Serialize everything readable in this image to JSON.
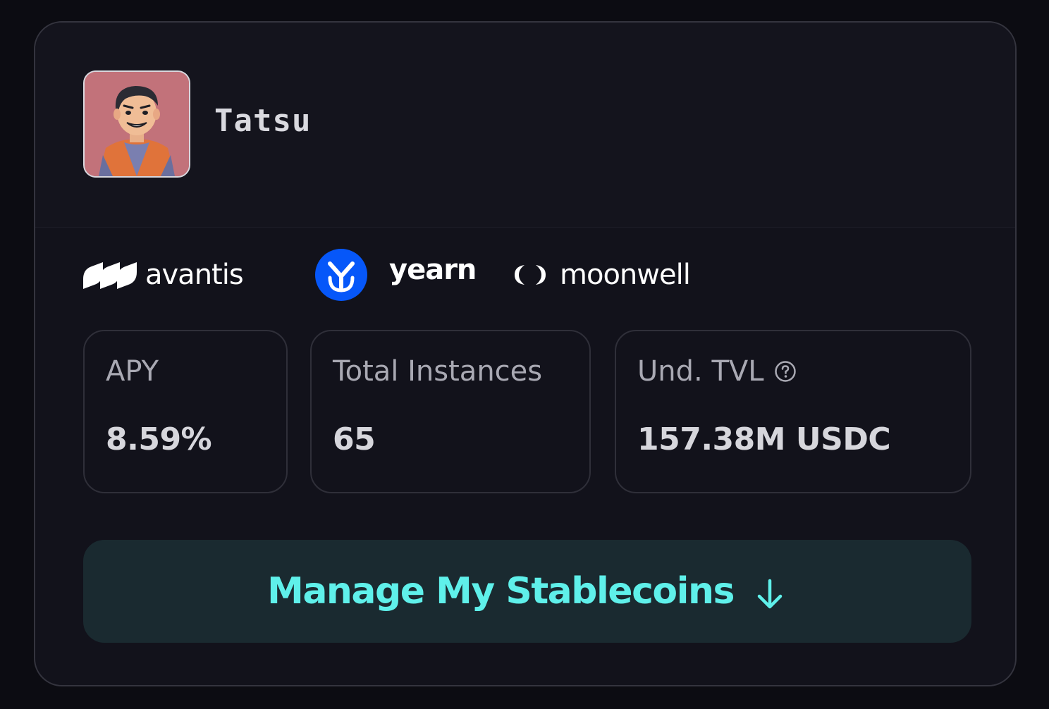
{
  "profile": {
    "username": "Tatsu",
    "avatar_icon": "cartoon-avatar-icon"
  },
  "protocols": [
    {
      "name": "avantis",
      "icon": "avantis-logo-icon"
    },
    {
      "name": "yearn",
      "icon": "yearn-logo-icon"
    },
    {
      "name": "moonwell",
      "icon": "moonwell-logo-icon"
    }
  ],
  "stats": {
    "apy": {
      "label": "APY",
      "value": "8.59%"
    },
    "instances": {
      "label": "Total Instances",
      "value": "65"
    },
    "tvl": {
      "label": "Und. TVL",
      "value": "157.38M USDC",
      "icon": "help-circle-icon"
    }
  },
  "action": {
    "label": "Manage My Stablecoins",
    "icon": "arrow-down-icon"
  },
  "colors": {
    "background": "#0c0c12",
    "card": "#12121b",
    "accent": "#5ff0ea",
    "button_bg": "#1a2a30",
    "avatar_bg": "#c2727a",
    "yearn_blue": "#0657f9"
  }
}
